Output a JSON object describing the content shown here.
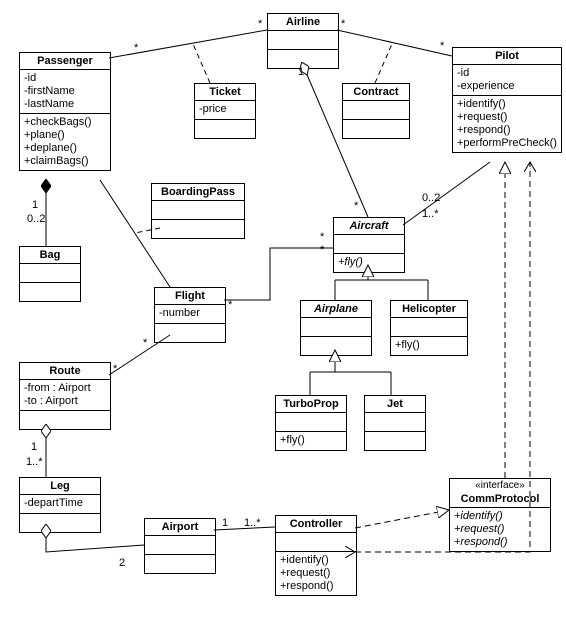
{
  "classes": {
    "airline": {
      "name": "Airline"
    },
    "passenger": {
      "name": "Passenger",
      "attrs": [
        "-id",
        "-firstName",
        "-lastName"
      ],
      "ops": [
        "+checkBags()",
        "+plane()",
        "+deplane()",
        "+claimBags()"
      ]
    },
    "ticket": {
      "name": "Ticket",
      "attrs": [
        "-price"
      ]
    },
    "contract": {
      "name": "Contract"
    },
    "pilot": {
      "name": "Pilot",
      "attrs": [
        "-id",
        "-experience"
      ],
      "ops": [
        "+identify()",
        "+request()",
        "+respond()",
        "+performPreCheck()"
      ]
    },
    "boardingpass": {
      "name": "BoardingPass"
    },
    "bag": {
      "name": "Bag"
    },
    "aircraft": {
      "name": "Aircraft",
      "ops": [
        "+fly()"
      ]
    },
    "flight": {
      "name": "Flight",
      "attrs": [
        "-number"
      ]
    },
    "airplane": {
      "name": "Airplane"
    },
    "helicopter": {
      "name": "Helicopter",
      "ops": [
        "+fly()"
      ]
    },
    "route": {
      "name": "Route",
      "attrs": [
        "-from : Airport",
        "-to : Airport"
      ]
    },
    "turboprop": {
      "name": "TurboProp",
      "ops": [
        "+fly()"
      ]
    },
    "jet": {
      "name": "Jet"
    },
    "leg": {
      "name": "Leg",
      "attrs": [
        "-departTime"
      ]
    },
    "airport": {
      "name": "Airport"
    },
    "controller": {
      "name": "Controller",
      "ops": [
        "+identify()",
        "+request()",
        "+respond()"
      ]
    },
    "commprotocol": {
      "stereotype": "«interface»",
      "name": "CommProtocol",
      "ops": [
        "+identify()",
        "+request()",
        "+respond()"
      ]
    }
  },
  "labels": {
    "star1": "*",
    "star2": "*",
    "star3": "*",
    "star4": "*",
    "star5": "*",
    "star6": "*",
    "star7": "*",
    "star8": "*",
    "one1": "1",
    "one2": "1",
    "one3": "1",
    "one4": "1",
    "zero2a": "0..2",
    "zero2b": "0..2",
    "oneplus1": "1..*",
    "oneplus2": "1..*",
    "oneplus3": "1..*",
    "two": "2"
  },
  "chart_data": {
    "type": "uml-class-diagram",
    "classes": [
      {
        "name": "Airline",
        "abstract": false,
        "attributes": [],
        "operations": []
      },
      {
        "name": "Passenger",
        "abstract": false,
        "attributes": [
          "-id",
          "-firstName",
          "-lastName"
        ],
        "operations": [
          "+checkBags()",
          "+plane()",
          "+deplane()",
          "+claimBags()"
        ]
      },
      {
        "name": "Ticket",
        "abstract": false,
        "attributes": [
          "-price"
        ],
        "operations": []
      },
      {
        "name": "Contract",
        "abstract": false,
        "attributes": [],
        "operations": []
      },
      {
        "name": "Pilot",
        "abstract": false,
        "attributes": [
          "-id",
          "-experience"
        ],
        "operations": [
          "+identify()",
          "+request()",
          "+respond()",
          "+performPreCheck()"
        ]
      },
      {
        "name": "BoardingPass",
        "abstract": false,
        "attributes": [],
        "operations": []
      },
      {
        "name": "Bag",
        "abstract": false,
        "attributes": [],
        "operations": []
      },
      {
        "name": "Aircraft",
        "abstract": true,
        "attributes": [],
        "operations": [
          "+fly()"
        ]
      },
      {
        "name": "Flight",
        "abstract": false,
        "attributes": [
          "-number"
        ],
        "operations": []
      },
      {
        "name": "Airplane",
        "abstract": true,
        "attributes": [],
        "operations": []
      },
      {
        "name": "Helicopter",
        "abstract": false,
        "attributes": [],
        "operations": [
          "+fly()"
        ]
      },
      {
        "name": "Route",
        "abstract": false,
        "attributes": [
          "-from : Airport",
          "-to : Airport"
        ],
        "operations": []
      },
      {
        "name": "TurboProp",
        "abstract": false,
        "attributes": [],
        "operations": [
          "+fly()"
        ]
      },
      {
        "name": "Jet",
        "abstract": false,
        "attributes": [],
        "operations": []
      },
      {
        "name": "Leg",
        "abstract": false,
        "attributes": [
          "-departTime"
        ],
        "operations": []
      },
      {
        "name": "Airport",
        "abstract": false,
        "attributes": [],
        "operations": []
      },
      {
        "name": "Controller",
        "abstract": false,
        "attributes": [],
        "operations": [
          "+identify()",
          "+request()",
          "+respond()"
        ]
      },
      {
        "name": "CommProtocol",
        "stereotype": "interface",
        "abstract": false,
        "attributes": [],
        "operations": [
          "+identify()",
          "+request()",
          "+respond()"
        ]
      }
    ],
    "relationships": [
      {
        "type": "association",
        "from": "Airline",
        "to": "Passenger",
        "from_mult": "*",
        "to_mult": "*",
        "assoc_class": "Ticket"
      },
      {
        "type": "association",
        "from": "Airline",
        "to": "Pilot",
        "from_mult": "*",
        "to_mult": "*",
        "assoc_class": "Contract"
      },
      {
        "type": "aggregation",
        "whole": "Airline",
        "part": "Aircraft",
        "whole_mult": "1",
        "part_mult": "*"
      },
      {
        "type": "composition",
        "whole": "Passenger",
        "part": "Bag",
        "whole_mult": "1",
        "part_mult": "0..2"
      },
      {
        "type": "association",
        "from": "Passenger",
        "to": "Flight",
        "from_mult": "*",
        "to_mult": "*",
        "assoc_class": "BoardingPass"
      },
      {
        "type": "association",
        "from": "Aircraft",
        "to": "Pilot",
        "from_mult": "0..2",
        "to_mult": "1..*"
      },
      {
        "type": "association",
        "from": "Aircraft",
        "to": "Flight",
        "from_mult": "*",
        "to_mult": "*"
      },
      {
        "type": "generalization",
        "parent": "Aircraft",
        "child": "Airplane"
      },
      {
        "type": "generalization",
        "parent": "Aircraft",
        "child": "Helicopter"
      },
      {
        "type": "generalization",
        "parent": "Airplane",
        "child": "TurboProp"
      },
      {
        "type": "generalization",
        "parent": "Airplane",
        "child": "Jet"
      },
      {
        "type": "association",
        "from": "Route",
        "to": "Flight",
        "from_mult": "*",
        "to_mult": "*"
      },
      {
        "type": "aggregation",
        "whole": "Route",
        "part": "Leg",
        "whole_mult": "1",
        "part_mult": "1..*"
      },
      {
        "type": "aggregation",
        "whole": "Leg",
        "part": "Airport",
        "whole_mult": "",
        "part_mult": "2"
      },
      {
        "type": "association",
        "from": "Airport",
        "to": "Controller",
        "from_mult": "1",
        "to_mult": "1..*"
      },
      {
        "type": "realization",
        "interface": "CommProtocol",
        "class": "Controller"
      },
      {
        "type": "realization",
        "interface": "CommProtocol",
        "class": "Pilot"
      },
      {
        "type": "dependency",
        "from": "Controller",
        "to": "Pilot"
      }
    ]
  }
}
